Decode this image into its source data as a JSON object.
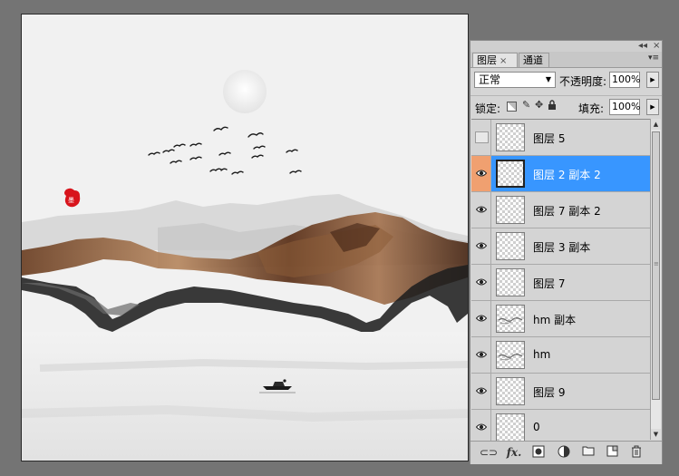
{
  "panel": {
    "tabs": [
      {
        "label": "图层",
        "close": "×"
      },
      {
        "label": "通道"
      }
    ],
    "top_buttons": {
      "minimize": "◂◂",
      "close": "×"
    },
    "menu_icon": "▾≡",
    "blend_mode": "正常",
    "opacity_label": "不透明度:",
    "opacity_value": "100%",
    "lock_label": "锁定:",
    "fill_label": "填充:",
    "fill_value": "100%"
  },
  "layers": [
    {
      "name": "图层 5",
      "visible": false,
      "selected": false
    },
    {
      "name": "图层 2 副本 2",
      "visible": true,
      "selected": true
    },
    {
      "name": "图层 7 副本 2",
      "visible": true,
      "selected": false
    },
    {
      "name": "图层 3 副本",
      "visible": true,
      "selected": false
    },
    {
      "name": "图层 7",
      "visible": true,
      "selected": false
    },
    {
      "name": "hm 副本",
      "visible": true,
      "selected": false
    },
    {
      "name": "hm",
      "visible": true,
      "selected": false
    },
    {
      "name": "图层 9",
      "visible": true,
      "selected": false
    },
    {
      "name": "0",
      "visible": true,
      "selected": false
    }
  ],
  "colors": {
    "selected_row": "#3896ff",
    "selected_eye_cell": "#f0a070",
    "panel_bg": "#d4d4d4",
    "seal_red": "#d8141c",
    "ink_brown": "#7a4a2c"
  },
  "icons": {
    "bottom_bar": [
      "link-layers-icon",
      "fx-style-icon",
      "add-mask-icon",
      "adjustment-layer-icon",
      "new-group-icon",
      "new-layer-icon",
      "delete-layer-icon"
    ]
  }
}
